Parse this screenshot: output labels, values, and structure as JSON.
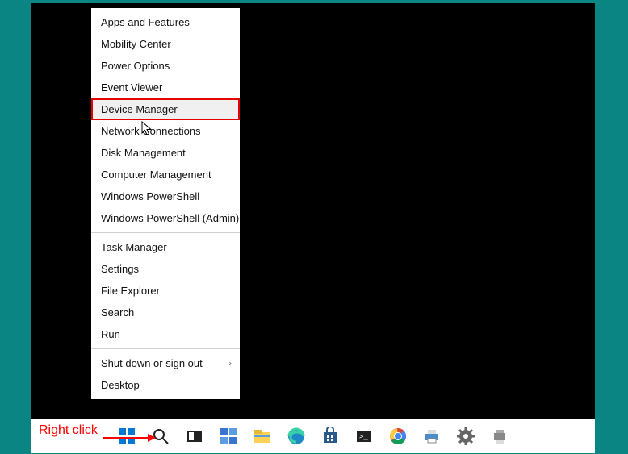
{
  "context_menu": {
    "groups": [
      {
        "items": [
          {
            "id": "apps-features",
            "label": "Apps and Features"
          },
          {
            "id": "mobility-center",
            "label": "Mobility Center"
          },
          {
            "id": "power-options",
            "label": "Power Options"
          },
          {
            "id": "event-viewer",
            "label": "Event Viewer"
          },
          {
            "id": "device-manager",
            "label": "Device Manager",
            "highlighted": true,
            "hover": true
          },
          {
            "id": "network-connections",
            "label": "Network Connections"
          },
          {
            "id": "disk-management",
            "label": "Disk Management"
          },
          {
            "id": "computer-management",
            "label": "Computer Management"
          },
          {
            "id": "windows-powershell",
            "label": "Windows PowerShell"
          },
          {
            "id": "windows-powershell-admin",
            "label": "Windows PowerShell (Admin)"
          }
        ]
      },
      {
        "items": [
          {
            "id": "task-manager",
            "label": "Task Manager"
          },
          {
            "id": "settings",
            "label": "Settings"
          },
          {
            "id": "file-explorer",
            "label": "File Explorer"
          },
          {
            "id": "search",
            "label": "Search"
          },
          {
            "id": "run",
            "label": "Run"
          }
        ]
      },
      {
        "items": [
          {
            "id": "shutdown-signout",
            "label": "Shut down or sign out",
            "submenu": true
          },
          {
            "id": "desktop",
            "label": "Desktop"
          }
        ]
      }
    ]
  },
  "taskbar_items": [
    {
      "id": "start",
      "name": "start-button"
    },
    {
      "id": "search",
      "name": "search-icon"
    },
    {
      "id": "taskview",
      "name": "task-view-icon"
    },
    {
      "id": "widgets",
      "name": "widgets-icon"
    },
    {
      "id": "explorer",
      "name": "file-explorer-icon"
    },
    {
      "id": "edge",
      "name": "edge-icon"
    },
    {
      "id": "store",
      "name": "store-icon"
    },
    {
      "id": "terminal",
      "name": "terminal-icon"
    },
    {
      "id": "chrome",
      "name": "chrome-icon"
    },
    {
      "id": "printer",
      "name": "printer-icon"
    },
    {
      "id": "gear",
      "name": "settings-icon"
    },
    {
      "id": "device",
      "name": "device-icon"
    }
  ],
  "annotation_text": "Right click"
}
